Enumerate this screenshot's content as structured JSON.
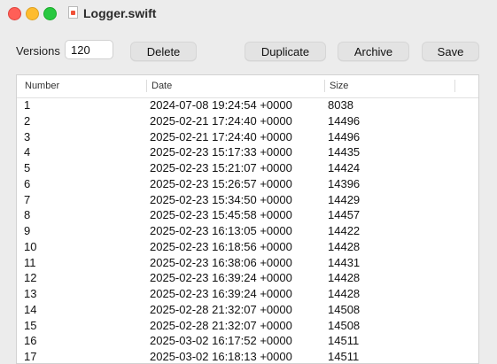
{
  "window": {
    "title": "Logger.swift"
  },
  "toolbar": {
    "versions_label": "Versions",
    "versions_value": "120",
    "delete_label": "Delete",
    "duplicate_label": "Duplicate",
    "archive_label": "Archive",
    "save_label": "Save"
  },
  "table": {
    "columns": [
      "Number",
      "Date",
      "Size"
    ],
    "rows": [
      {
        "number": "1",
        "date": "2024-07-08 19:24:54 +0000",
        "size": "8038"
      },
      {
        "number": "2",
        "date": "2025-02-21 17:24:40 +0000",
        "size": "14496"
      },
      {
        "number": "3",
        "date": "2025-02-21 17:24:40 +0000",
        "size": "14496"
      },
      {
        "number": "4",
        "date": "2025-02-23 15:17:33 +0000",
        "size": "14435"
      },
      {
        "number": "5",
        "date": "2025-02-23 15:21:07 +0000",
        "size": "14424"
      },
      {
        "number": "6",
        "date": "2025-02-23 15:26:57 +0000",
        "size": "14396"
      },
      {
        "number": "7",
        "date": "2025-02-23 15:34:50 +0000",
        "size": "14429"
      },
      {
        "number": "8",
        "date": "2025-02-23 15:45:58 +0000",
        "size": "14457"
      },
      {
        "number": "9",
        "date": "2025-02-23 16:13:05 +0000",
        "size": "14422"
      },
      {
        "number": "10",
        "date": "2025-02-23 16:18:56 +0000",
        "size": "14428"
      },
      {
        "number": "11",
        "date": "2025-02-23 16:38:06 +0000",
        "size": "14431"
      },
      {
        "number": "12",
        "date": "2025-02-23 16:39:24 +0000",
        "size": "14428"
      },
      {
        "number": "13",
        "date": "2025-02-23 16:39:24 +0000",
        "size": "14428"
      },
      {
        "number": "14",
        "date": "2025-02-28 21:32:07 +0000",
        "size": "14508"
      },
      {
        "number": "15",
        "date": "2025-02-28 21:32:07 +0000",
        "size": "14508"
      },
      {
        "number": "16",
        "date": "2025-03-02 16:17:52 +0000",
        "size": "14511"
      },
      {
        "number": "17",
        "date": "2025-03-02 16:18:13 +0000",
        "size": "14511"
      }
    ]
  }
}
